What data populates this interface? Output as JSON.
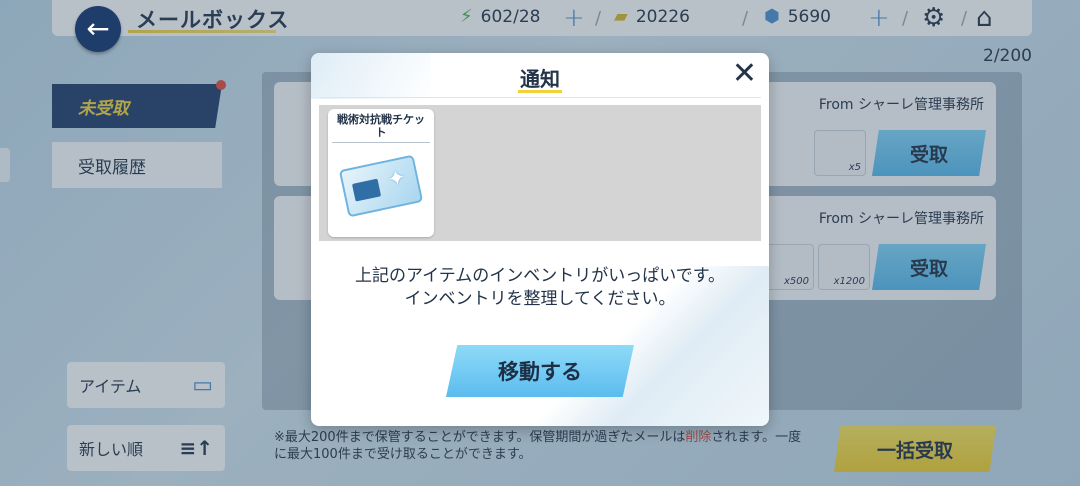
{
  "header": {
    "back_icon": "←",
    "title": "メールボックス",
    "ap": "602/28",
    "credits": "20226",
    "gems": "5690",
    "plus": "+",
    "settings_icon": "⚙",
    "home_icon": "⌂"
  },
  "mailbox": {
    "count": "2/200",
    "tabs": {
      "unreceived": "未受取",
      "history": "受取履歴"
    },
    "mails": [
      {
        "from": "From シャーレ管理事務所",
        "rewards": [
          "x5"
        ],
        "receive": "受取"
      },
      {
        "from": "From シャーレ管理事務所",
        "rewards": [
          "x500",
          "x1200"
        ],
        "receive": "受取"
      }
    ],
    "filter_item": "アイテム",
    "sort_new": "新しい順",
    "notice_a": "※最大200件まで保管することができます。保管期間が過ぎたメールは",
    "notice_del": "削除",
    "notice_b": "されます。一度に最大100件まで受け取ることができます。",
    "bulk_receive": "一括受取"
  },
  "dialog": {
    "title": "通知",
    "close": "✕",
    "item_name": "戦術対抗戦チケット",
    "message_line1": "上記のアイテムのインベントリがいっぱいです。",
    "message_line2": "インベントリを整理してください。",
    "move_button": "移動する"
  },
  "colors": {
    "navy": "#1f3d6b",
    "accent_yellow": "#f1d23a",
    "button_blue": "#5bbcee",
    "alert_red": "#d24b3a"
  }
}
